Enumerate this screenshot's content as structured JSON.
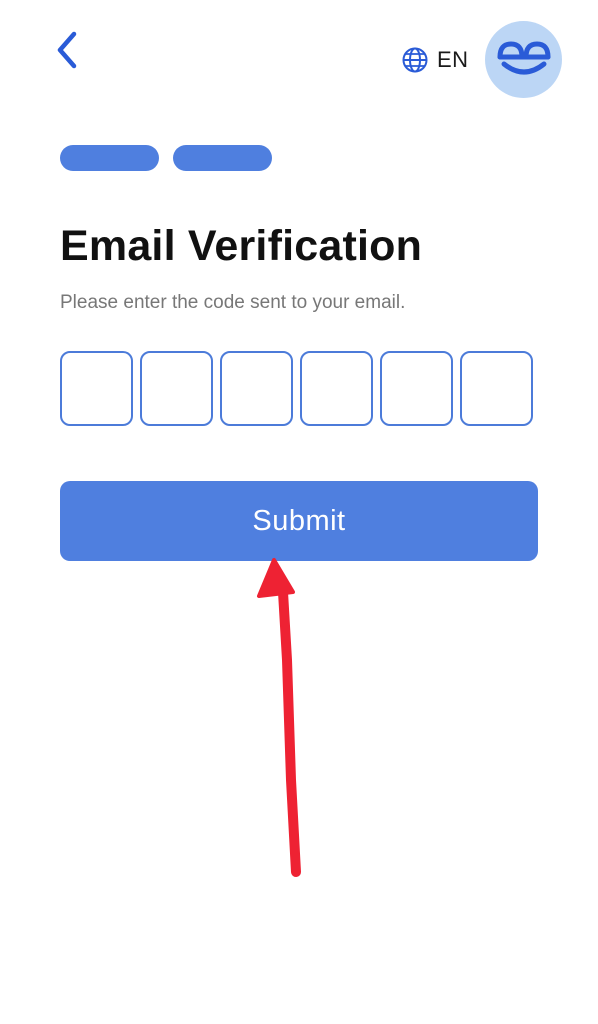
{
  "header": {
    "back_icon": "chevron-left-icon",
    "language_icon": "globe-icon",
    "language_label": "EN",
    "avatar_icon": "smiley-logo-icon"
  },
  "progress": {
    "total_steps": 2,
    "completed_steps": 2
  },
  "main": {
    "title": "Email Verification",
    "subtitle": "Please enter the code sent to your email.",
    "code_length": 6,
    "code_values": [
      "",
      "",
      "",
      "",
      "",
      ""
    ],
    "submit_label": "Submit"
  },
  "annotation": {
    "type": "arrow",
    "color": "#ee2233",
    "points_to": "submit-button"
  },
  "colors": {
    "accent": "#4f7fdf",
    "accent_dark": "#2a5bd7",
    "avatar_bg": "#bcd6f5",
    "input_border": "#4c7bd9",
    "annotation": "#ee2233"
  }
}
